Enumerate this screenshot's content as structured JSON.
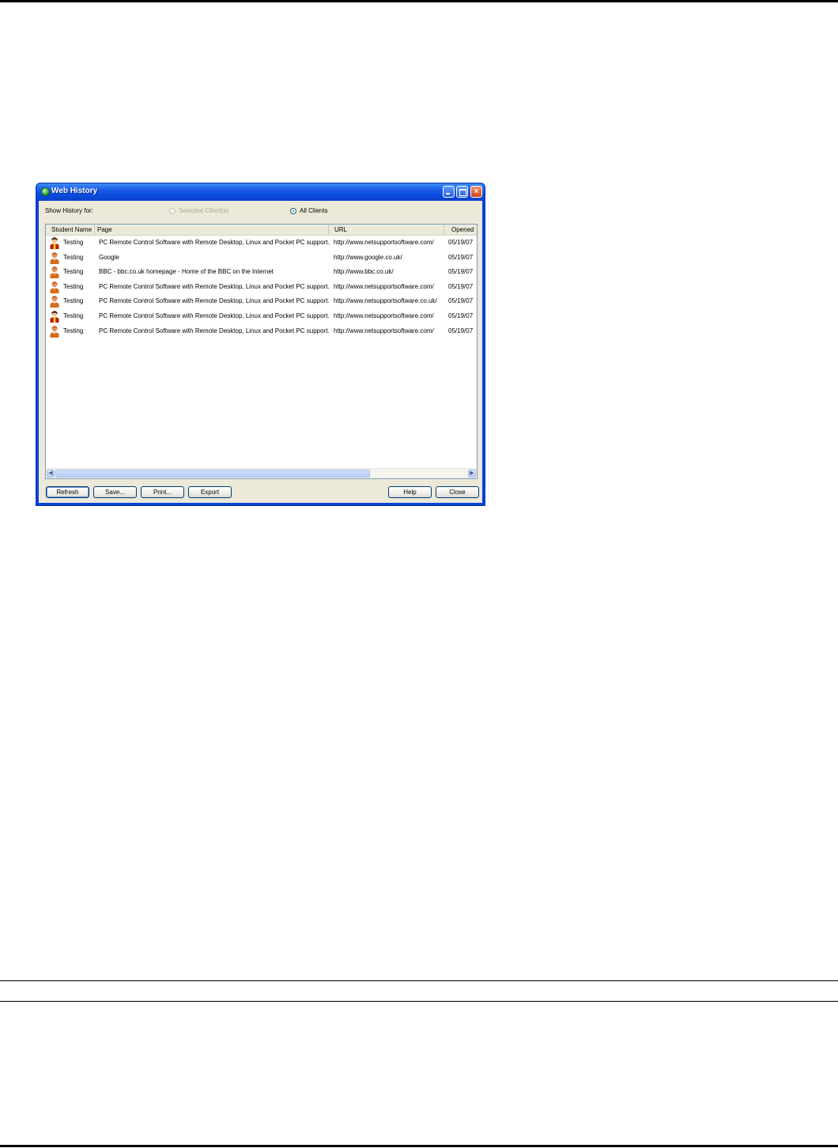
{
  "window": {
    "title": "Web History",
    "show_history_label": "Show History for:",
    "radio_selected_clients": "Selected Client(s)",
    "radio_all_clients": "All Clients",
    "selected_option": "All Clients"
  },
  "table": {
    "columns": [
      "Student Name",
      "Page",
      "URL",
      "Opened"
    ],
    "rows": [
      {
        "avatar": "student-avatar-icon",
        "name": "Testing",
        "page": "PC Remote Control Software with Remote Desktop, Linux and Pocket PC support.",
        "url": "http://www.netsupportsoftware.com/",
        "opened": "05/19/07"
      },
      {
        "avatar": "user-avatar-icon",
        "name": "Testing",
        "page": "Google",
        "url": "http://www.google.co.uk/",
        "opened": "05/19/07"
      },
      {
        "avatar": "user-avatar-icon",
        "name": "Testing",
        "page": "BBC - bbc.co.uk homepage - Home of the BBC on the Internet",
        "url": "http://www.bbc.co.uk/",
        "opened": "05/19/07"
      },
      {
        "avatar": "user-avatar-icon",
        "name": "Testing",
        "page": "PC Remote Control Software with Remote Desktop, Linux and Pocket PC support.",
        "url": "http://www.netsupportsoftware.com/",
        "opened": "05/19/07"
      },
      {
        "avatar": "user-avatar-icon",
        "name": "Testing",
        "page": "PC Remote Control Software with Remote Desktop, Linux and Pocket PC support.",
        "url": "http://www.netsupportsoftware.co.uk/",
        "opened": "05/19/07"
      },
      {
        "avatar": "student-avatar-icon",
        "name": "Testing",
        "page": "PC Remote Control Software with Remote Desktop, Linux and Pocket PC support.",
        "url": "http://www.netsupportsoftware.com/",
        "opened": "05/19/07"
      },
      {
        "avatar": "user-avatar-icon",
        "name": "Testing",
        "page": "PC Remote Control Software with Remote Desktop, Linux and Pocket PC support.",
        "url": "http://www.netsupportsoftware.com/",
        "opened": "05/19/07"
      }
    ]
  },
  "buttons": {
    "refresh": "Refresh",
    "save": "Save...",
    "print": "Print...",
    "export": "Export",
    "help": "Help",
    "close": "Close"
  },
  "titlebar_glyphs": {
    "close": "×"
  },
  "colors": {
    "titlebar_blue": "#0a49dc",
    "dialog_face": "#ece9d8",
    "list_border": "#7f9db9"
  }
}
